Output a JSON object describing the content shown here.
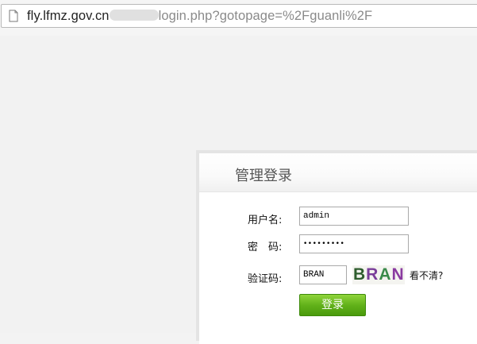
{
  "browser": {
    "url_host": "fly.lfmz.gov.cn",
    "url_path": "login.php?gotopage=%2Fguanli%2F",
    "page_icon": "document-icon"
  },
  "login": {
    "title": "管理登录",
    "username_label": "用户名:",
    "username_value": "admin",
    "password_label": "密　码:",
    "password_display": "•••••••••",
    "captcha_label": "验证码:",
    "captcha_value": "BRAN",
    "captcha_image_text": "BRAN",
    "refresh_label": "看不清?",
    "submit_label": "登录"
  }
}
